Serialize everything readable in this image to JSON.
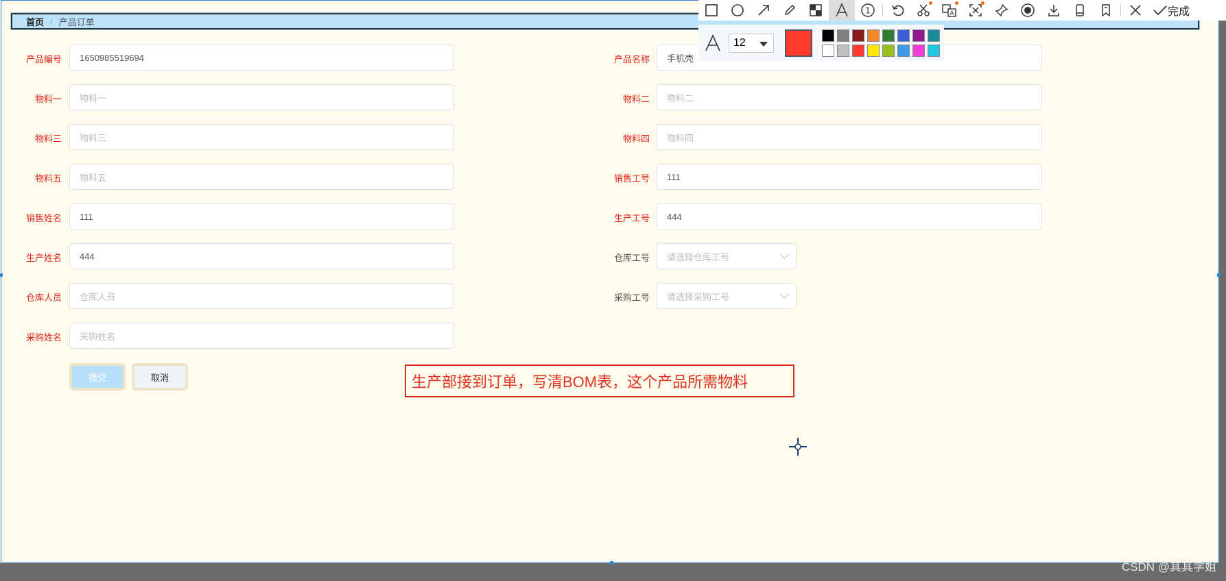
{
  "breadcrumb": {
    "home": "首页",
    "separator": "/",
    "current": "产品订单"
  },
  "form": {
    "product_code": {
      "label": "产品编号",
      "value": "1650985519694"
    },
    "product_name": {
      "label": "产品名称",
      "value": "手机壳"
    },
    "material1": {
      "label": "物料一",
      "placeholder": "物料一"
    },
    "material2": {
      "label": "物料二",
      "placeholder": "物料二"
    },
    "material3": {
      "label": "物料三",
      "placeholder": "物料三"
    },
    "material4": {
      "label": "物料四",
      "placeholder": "物料四"
    },
    "material5": {
      "label": "物料五",
      "placeholder": "物料五"
    },
    "sales_id": {
      "label": "销售工号",
      "value": "111"
    },
    "sales_name": {
      "label": "销售姓名",
      "value": "111"
    },
    "production_id": {
      "label": "生产工号",
      "value": "444"
    },
    "production_name": {
      "label": "生产姓名",
      "value": "444"
    },
    "warehouse_id": {
      "label": "仓库工号",
      "placeholder": "请选择仓库工号"
    },
    "warehouse_staff": {
      "label": "仓库人员",
      "placeholder": "仓库人员"
    },
    "purchase_id": {
      "label": "采购工号",
      "placeholder": "请选择采购工号"
    },
    "purchase_name": {
      "label": "采购姓名",
      "placeholder": "采购姓名"
    },
    "submit_label": "提交",
    "cancel_label": "取消"
  },
  "annotation": {
    "text": "生产部接到订单，写清BOM表，这个产品所需物料"
  },
  "capture_toolbar": {
    "tools": [
      "rectangle-icon",
      "ellipse-icon",
      "arrow-icon",
      "pencil-icon",
      "mosaic-icon",
      "text-icon",
      "number-icon",
      "undo-icon",
      "cut-icon",
      "translate-icon",
      "ocr-icon",
      "pin-icon",
      "record-icon",
      "download-icon",
      "long-screenshot-icon",
      "bookmark-icon",
      "close-icon"
    ],
    "done_label": "完成",
    "font_size": "12",
    "current_color": "#ff3b2f",
    "palette": [
      "#000000",
      "#808080",
      "#8b1a1a",
      "#f5862b",
      "#2e7d32",
      "#3b5fd9",
      "#8e1a8e",
      "#1a8a9a",
      "#ffffff",
      "#c0c0c0",
      "#ff3b2f",
      "#ffe600",
      "#9bbf1f",
      "#3a9ae8",
      "#f53bd8",
      "#1ec8e0"
    ]
  },
  "watermark": "CSDN @其其学姐"
}
